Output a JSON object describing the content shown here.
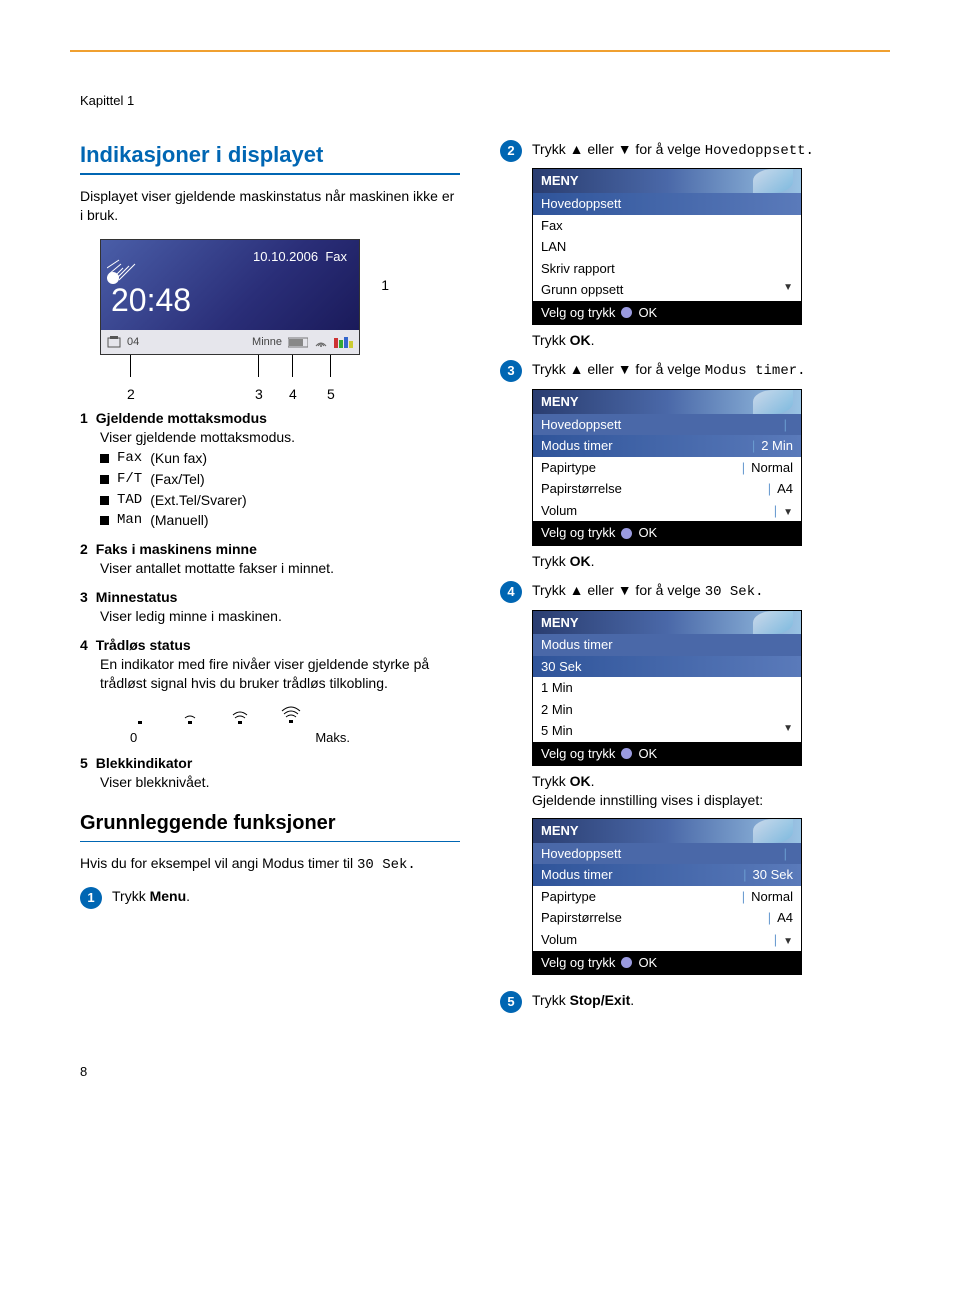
{
  "chapter_label": "Kapittel 1",
  "section_title": "Indikasjoner i displayet",
  "section_intro": "Displayet viser gjeldende maskinstatus når maskinen ikke er i bruk.",
  "lcd": {
    "date": "10.10.2006",
    "mode": "Fax",
    "time": "20:48",
    "fax_count": "04",
    "memory_label": "Minne"
  },
  "callout_labels": {
    "c1": "1",
    "c2": "2",
    "c3": "3",
    "c4": "4",
    "c5": "5"
  },
  "definitions": [
    {
      "num": "1",
      "title": "Gjeldende mottaksmodus",
      "body": "Viser gjeldende mottaksmodus.",
      "subs": [
        {
          "code": "Fax",
          "desc": "(Kun fax)"
        },
        {
          "code": "F/T",
          "desc": "(Fax/Tel)"
        },
        {
          "code": "TAD",
          "desc": "(Ext.Tel/Svarer)"
        },
        {
          "code": "Man",
          "desc": "(Manuell)"
        }
      ]
    },
    {
      "num": "2",
      "title": "Faks i maskinens minne",
      "body": "Viser antallet mottatte fakser i minnet."
    },
    {
      "num": "3",
      "title": "Minnestatus",
      "body": "Viser ledig minne i maskinen."
    },
    {
      "num": "4",
      "title": "Trådløs status",
      "body": "En indikator med fire nivåer viser gjeldende styrke på trådløst signal hvis du bruker trådløs tilkobling."
    },
    {
      "num": "5",
      "title": "Blekkindikator",
      "body": "Viser blekknivået."
    }
  ],
  "wifi_scale": {
    "min": "0",
    "max": "Maks."
  },
  "subsection_title": "Grunnleggende funksjoner",
  "subsection_intro_a": "Hvis du for eksempel vil angi Modus timer til ",
  "subsection_intro_b": "30 Sek.",
  "steps": {
    "s1": "Trykk ",
    "s1_bold": "Menu",
    "s1_end": ".",
    "s2_a": "Trykk ",
    "s2_b": " eller ",
    "s2_c": " for å velge ",
    "s2_target": "Hovedoppsett.",
    "ok_line": "Trykk ",
    "ok_bold": "OK",
    "ok_end": ".",
    "s3_a": "Trykk ",
    "s3_b": " eller ",
    "s3_c": " for å velge ",
    "s3_target": "Modus timer.",
    "s4_a": "Trykk ",
    "s4_b": " eller ",
    "s4_c": " for å velge ",
    "s4_target": "30 Sek.",
    "post4": "Gjeldende innstilling vises i displayet:",
    "s5_a": "Trykk ",
    "s5_bold": "Stop/Exit",
    "s5_end": "."
  },
  "menu_common": {
    "title": "MENY",
    "footer_prefix": "Velg og trykk",
    "footer_ok": "OK"
  },
  "menu1": {
    "sel": "Hovedoppsett",
    "rows": [
      "Fax",
      "LAN",
      "Skriv rapport",
      "Grunn oppsett"
    ]
  },
  "menu2": {
    "header_sub": "Hovedoppsett",
    "rows": [
      {
        "l": "Modus timer",
        "r": "2 Min",
        "sel": true
      },
      {
        "l": "Papirtype",
        "r": "Normal"
      },
      {
        "l": "Papirstørrelse",
        "r": "A4"
      },
      {
        "l": "Volum",
        "r": ""
      }
    ]
  },
  "menu3": {
    "header_sub": "Modus timer",
    "rows": [
      "30 Sek",
      "1 Min",
      "2 Min",
      "5 Min"
    ],
    "sel_index": 0
  },
  "menu4": {
    "header_sub": "Hovedoppsett",
    "rows": [
      {
        "l": "Modus timer",
        "r": "30 Sek",
        "sel": true
      },
      {
        "l": "Papirtype",
        "r": "Normal"
      },
      {
        "l": "Papirstørrelse",
        "r": "A4"
      },
      {
        "l": "Volum",
        "r": ""
      }
    ]
  },
  "page_number": "8"
}
